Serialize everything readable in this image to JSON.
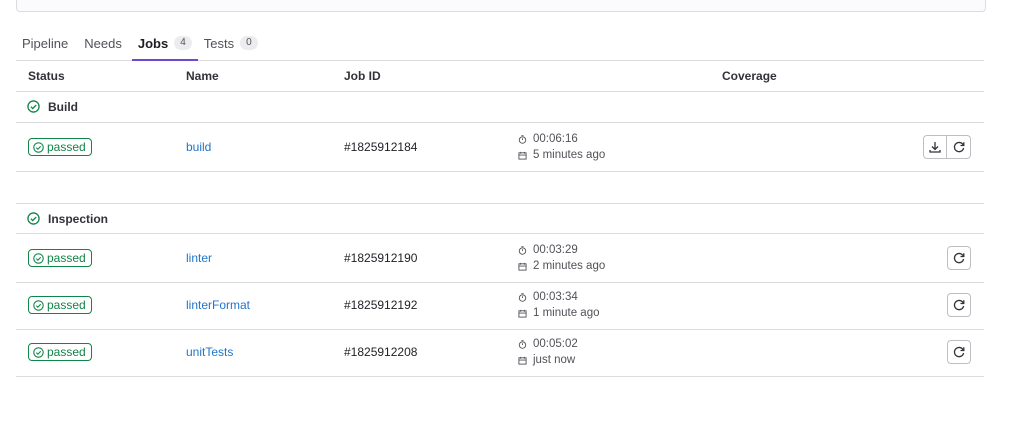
{
  "tabs": [
    {
      "label": "Pipeline",
      "count": null
    },
    {
      "label": "Needs",
      "count": null
    },
    {
      "label": "Jobs",
      "count": "4"
    },
    {
      "label": "Tests",
      "count": "0"
    }
  ],
  "columns": {
    "status": "Status",
    "name": "Name",
    "job_id": "Job ID",
    "coverage": "Coverage"
  },
  "groups": [
    {
      "name": "Build",
      "jobs": [
        {
          "status": "passed",
          "name": "build",
          "id": "#1825912184",
          "duration": "00:06:16",
          "finished": "5 minutes ago"
        }
      ]
    },
    {
      "name": "Inspection",
      "jobs": [
        {
          "status": "passed",
          "name": "linter",
          "id": "#1825912190",
          "duration": "00:03:29",
          "finished": "2 minutes ago"
        },
        {
          "status": "passed",
          "name": "linterFormat",
          "id": "#1825912192",
          "duration": "00:03:34",
          "finished": "1 minute ago"
        },
        {
          "status": "passed",
          "name": "unitTests",
          "id": "#1825912208",
          "duration": "00:05:02",
          "finished": "just now"
        }
      ]
    }
  ],
  "colors": {
    "success": "#108548",
    "link": "#1f75cb",
    "tab_active": "#6e49cb"
  },
  "icons": {
    "status": "status-success-icon",
    "duration": "timer-icon",
    "finished": "calendar-icon",
    "download": "download-icon",
    "retry": "retry-icon"
  }
}
